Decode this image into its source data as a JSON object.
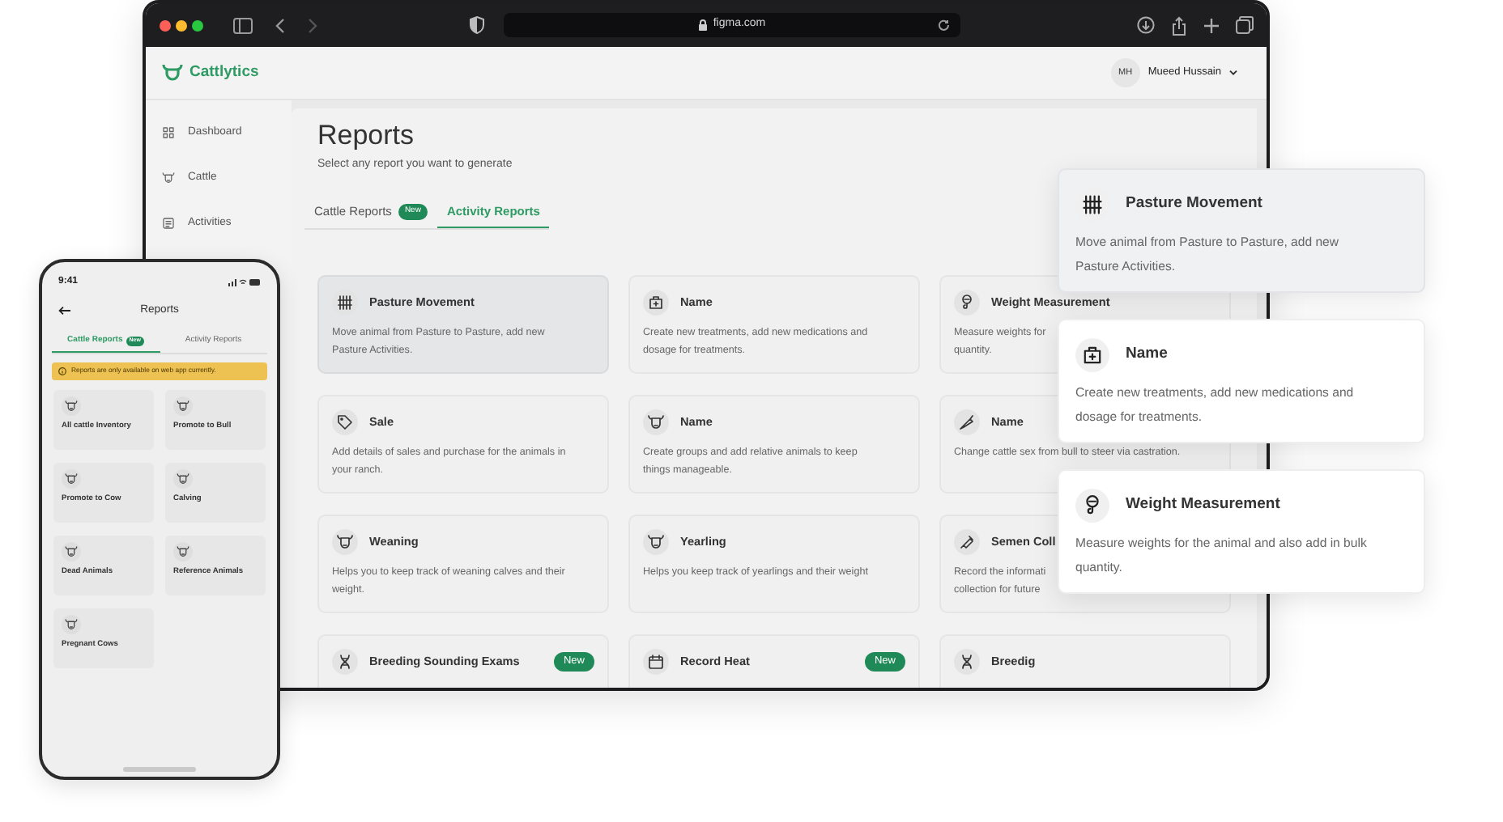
{
  "browser": {
    "url": "figma.com"
  },
  "app": {
    "logo": "Cattlytics",
    "user": {
      "initials": "MH",
      "name": "Mueed Hussain"
    },
    "sidebar": [
      {
        "label": "Dashboard"
      },
      {
        "label": "Cattle"
      },
      {
        "label": "Activities"
      }
    ],
    "page": {
      "title": "Reports",
      "subtitle": "Select any report you want to generate",
      "tabs": [
        {
          "label": "Cattle Reports",
          "badge": "New",
          "selected": false
        },
        {
          "label": "Activity Reports",
          "selected": true
        }
      ],
      "cards": [
        {
          "title": "Pasture Movement",
          "lines": [
            "Move animal from Pasture to Pasture, add new",
            "Pasture Activities."
          ],
          "selected": true
        },
        {
          "title": "Name",
          "lines": [
            "Create new treatments, add new medications and",
            "dosage for treatments."
          ],
          "selected": false
        },
        {
          "title": "Weight Measurement",
          "lines": [
            "Measure weights for",
            "quantity."
          ],
          "selected": false
        },
        {
          "title": "Sale",
          "lines": [
            "Add details of sales and purchase for the animals in",
            "your ranch."
          ],
          "selected": false
        },
        {
          "title": "Name",
          "lines": [
            "Create groups and add relative animals to keep",
            "things manageable."
          ],
          "selected": false
        },
        {
          "title": "Name",
          "lines": [
            "Change cattle sex from bull to steer via castration."
          ],
          "selected": false
        },
        {
          "title": "Weaning",
          "lines": [
            "Helps you to keep track of weaning calves and their",
            "weight."
          ],
          "selected": false
        },
        {
          "title": "Yearling",
          "lines": [
            "Helps you keep track of yearlings and their weight"
          ],
          "selected": false
        },
        {
          "title": "Semen Coll",
          "lines": [
            "Record the informati",
            "collection for future"
          ],
          "selected": false
        },
        {
          "title": "Breeding Sounding Exams",
          "badge": "New",
          "selected": false
        },
        {
          "title": "Record Heat",
          "badge": "New",
          "selected": false
        },
        {
          "title": "Breedig",
          "selected": false
        }
      ]
    }
  },
  "phone": {
    "time": "9:41",
    "title": "Reports",
    "tabs": [
      {
        "label": "Cattle Reports",
        "badge": "New",
        "selected": true
      },
      {
        "label": "Activity Reports",
        "selected": false
      }
    ],
    "notice": "Reports are only available on web app currently.",
    "tiles": [
      {
        "label": "All cattle Inventory"
      },
      {
        "label": "Promote to Bull"
      },
      {
        "label": "Promote to Cow"
      },
      {
        "label": "Calving"
      },
      {
        "label": "Dead Animals"
      },
      {
        "label": "Reference Animals"
      },
      {
        "label": "Pregnant Cows"
      }
    ]
  },
  "popups": [
    {
      "title": "Pasture Movement",
      "lines": [
        "Move animal from Pasture to Pasture, add new",
        "Pasture Activities."
      ],
      "highlighted": true
    },
    {
      "title": "Name",
      "lines": [
        "Create new treatments, add new medications and",
        "dosage for treatments."
      ],
      "highlighted": false
    },
    {
      "title": "Weight Measurement",
      "lines": [
        "Measure weights for the animal and also add in bulk",
        "quantity."
      ],
      "highlighted": false
    }
  ]
}
